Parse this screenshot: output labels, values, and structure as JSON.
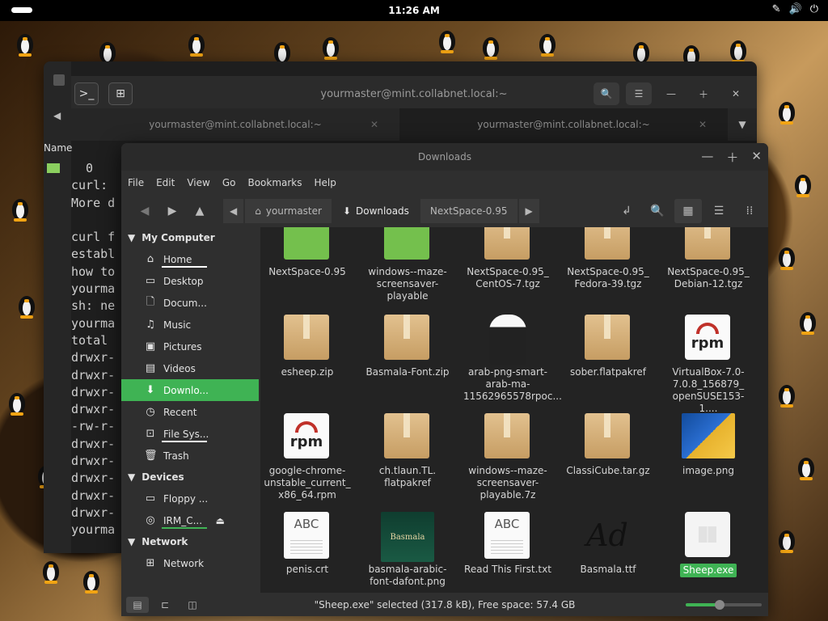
{
  "panel": {
    "clock": "11:26 AM"
  },
  "terminal": {
    "title": "yourmaster@mint.collabnet.local:~",
    "tabs": [
      {
        "label": "yourmaster@mint.collabnet.local:~"
      },
      {
        "label": "yourmaster@mint.collabnet.local:~"
      }
    ],
    "left_column_label": "Name",
    "lines": [
      "  0",
      "curl:",
      "More d",
      "",
      "curl f",
      "establ",
      "how to",
      "yourma",
      "sh: ne",
      "yourma",
      "total",
      "drwxr-",
      "drwxr-",
      "drwxr-",
      "drwxr-",
      "-rw-r-",
      "drwxr-",
      "drwxr-",
      "drwxr-",
      "drwxr-",
      "drwxr-",
      "yourma"
    ]
  },
  "fm": {
    "title": "Downloads",
    "menu": [
      "File",
      "Edit",
      "View",
      "Go",
      "Bookmarks",
      "Help"
    ],
    "crumbs": [
      "yourmaster",
      "Downloads",
      "NextSpace-0.95"
    ],
    "sidebar": {
      "my_computer": "My Computer",
      "computer_items": [
        "Home",
        "Desktop",
        "Docum...",
        "Music",
        "Pictures",
        "Videos",
        "Downlo...",
        "Recent",
        "File Sys...",
        "Trash"
      ],
      "devices": "Devices",
      "device_items": [
        "Floppy ...",
        "IRM_C..."
      ],
      "network": "Network",
      "network_items": [
        "Network"
      ]
    },
    "files": [
      {
        "name": "NextSpace-0.95",
        "kind": "folder-green"
      },
      {
        "name": "windows--maze-\nscreensaver-\nplayable",
        "kind": "folder-green"
      },
      {
        "name": "NextSpace-0.95_\nCentOS-7.tgz",
        "kind": "box"
      },
      {
        "name": "NextSpace-0.95_\nFedora-39.tgz",
        "kind": "box"
      },
      {
        "name": "NextSpace-0.95_\nDebian-12.tgz",
        "kind": "box"
      },
      {
        "name": "esheep.zip",
        "kind": "box"
      },
      {
        "name": "Basmala-Font.zip",
        "kind": "box"
      },
      {
        "name": "arab-png-smart-\narab-ma-\n11562965578rpoc...",
        "kind": "photo-man"
      },
      {
        "name": "sober.flatpakref",
        "kind": "box"
      },
      {
        "name": "VirtualBox-7.0-\n7.0.8_156879_\nopenSUSE153-1....",
        "kind": "rpm"
      },
      {
        "name": "google-chrome-\nunstable_current_\nx86_64.rpm",
        "kind": "rpm"
      },
      {
        "name": "ch.tlaun.TL.\nflatpakref",
        "kind": "box"
      },
      {
        "name": "windows--maze-\nscreensaver-\nplayable.7z",
        "kind": "box"
      },
      {
        "name": "ClassiCube.tar.gz",
        "kind": "box"
      },
      {
        "name": "image.png",
        "kind": "photo-pepsi"
      },
      {
        "name": "penis.crt",
        "kind": "txt"
      },
      {
        "name": "basmala-arabic-\nfont-dafont.png",
        "kind": "photo-basmala"
      },
      {
        "name": "Read This First.txt",
        "kind": "txt"
      },
      {
        "name": "Basmala.ttf",
        "kind": "font-ttf"
      },
      {
        "name": "Sheep.exe",
        "kind": "exe",
        "selected": true
      }
    ],
    "icon_texts": {
      "txt": "ABC",
      "rpm": "rpm",
      "ttf": "Ad",
      "basmala": "Basmala"
    },
    "status": "\"Sheep.exe\" selected (317.8 kB), Free space: 57.4 GB",
    "zoom_level": 0.45
  },
  "colors": {
    "accent": "#3fb354",
    "panel": "#000000",
    "window": "#2f2f2f"
  }
}
